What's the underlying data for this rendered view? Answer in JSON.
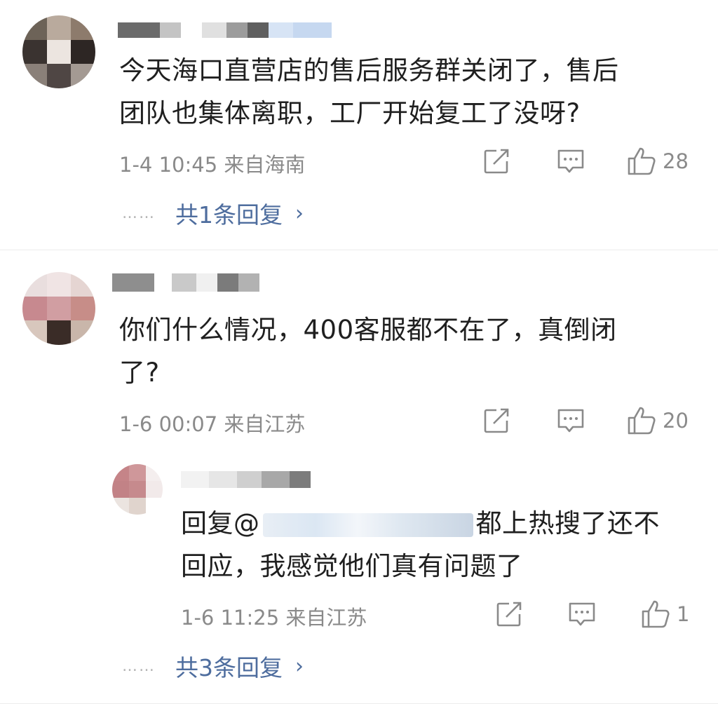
{
  "comments": [
    {
      "text_line1": "今天海口直营店的售后服务群关闭了，售后",
      "text_line2": "团队也集体离职，工厂开始复工了没呀?",
      "time_location": "1-4 10:45 来自海南",
      "likes": "28",
      "replies_label": "共1条回复",
      "icons": [
        "share-icon",
        "comment-icon",
        "like-icon"
      ]
    },
    {
      "text_line1": "你们什么情况，400客服都不在了，真倒闭",
      "text_line2": "了?",
      "time_location": "1-6 00:07 来自江苏",
      "likes": "20",
      "icons": [
        "share-icon",
        "comment-icon",
        "like-icon"
      ]
    },
    {
      "reply_prefix": "回复@",
      "text_line1_after_mention": "都上热搜了还不",
      "text_line2": "回应，我感觉他们真有问题了",
      "time_location": "1-6 11:25 来自江苏",
      "likes": "1",
      "replies_label": "共3条回复",
      "icons": [
        "share-icon",
        "comment-icon",
        "like-icon"
      ]
    }
  ],
  "ui": {
    "dots": "……",
    "chevron": "›"
  },
  "colors": {
    "link": "#4e6d9e",
    "meta": "#8a8a8a",
    "text": "#1f1f1f"
  }
}
